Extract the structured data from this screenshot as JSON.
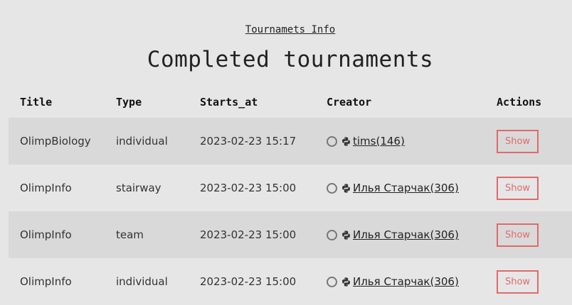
{
  "nav": {
    "info_link": "Tournamets Info"
  },
  "page": {
    "title": "Completed tournaments"
  },
  "table": {
    "headers": {
      "title": "Title",
      "type": "Type",
      "starts_at": "Starts_at",
      "creator": "Creator",
      "actions": "Actions"
    },
    "rows": [
      {
        "title": "OlimpBiology",
        "type": "individual",
        "starts_at": "2023-02-23 15:17",
        "creator": "tims(146)",
        "action": "Show",
        "icon": "python-icon"
      },
      {
        "title": "OlimpInfo",
        "type": "stairway",
        "starts_at": "2023-02-23 15:00",
        "creator": "Илья Старчак(306)",
        "action": "Show",
        "icon": "python-icon"
      },
      {
        "title": "OlimpInfo",
        "type": "team",
        "starts_at": "2023-02-23 15:00",
        "creator": "Илья Старчак(306)",
        "action": "Show",
        "icon": "python-icon"
      },
      {
        "title": "OlimpInfo",
        "type": "individual",
        "starts_at": "2023-02-23 15:00",
        "creator": "Илья Старчак(306)",
        "action": "Show",
        "icon": "python-icon"
      }
    ]
  },
  "colors": {
    "background": "#e6e6e6",
    "row_stripe": "#d9d9d9",
    "show_button": "#e06a6a"
  }
}
